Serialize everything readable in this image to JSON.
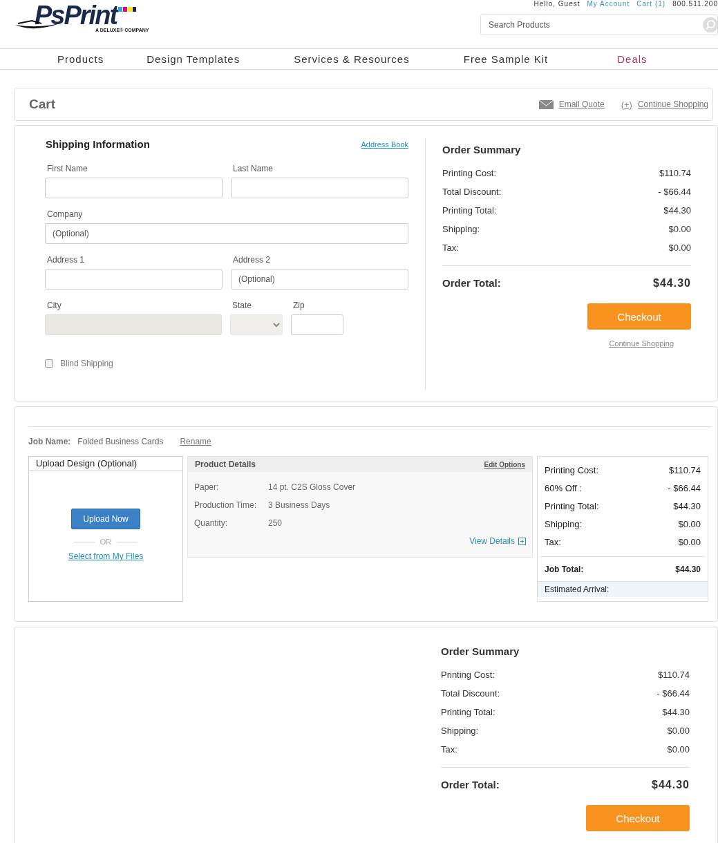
{
  "header": {
    "logo": {
      "name": "PsPrint",
      "tagline": "A DELUXE® COMPANY"
    },
    "greeting": "Hello, Guest",
    "account_link": "My Account",
    "cart_link": "Cart (1)",
    "phone": "800.511.200",
    "search": {
      "placeholder": "Search Products"
    }
  },
  "nav": [
    {
      "label": "Products",
      "kind": "normal"
    },
    {
      "label": "Design Templates",
      "kind": "normal"
    },
    {
      "label": "Services & Resources",
      "kind": "normal"
    },
    {
      "label": "Free Sample Kit",
      "kind": "normal"
    },
    {
      "label": "Deals",
      "kind": "promo"
    }
  ],
  "cart_bar": {
    "title": "Cart",
    "links": [
      {
        "label": "Email Quote",
        "kind": "email"
      },
      {
        "label": "Continue Shopping",
        "kind": "add",
        "icon": "(+)"
      }
    ]
  },
  "shipping": {
    "title": "Shipping Information",
    "address_book": "Address Book",
    "rows": [
      [
        {
          "label": "First Name",
          "kind": "text",
          "disabled": false
        },
        {
          "label": "Last Name",
          "kind": "text",
          "disabled": false
        }
      ],
      [
        {
          "label": "Company",
          "kind": "text",
          "placeholder": "(Optional)",
          "disabled": false
        }
      ],
      [
        {
          "label": "Address 1",
          "kind": "text",
          "disabled": false
        },
        {
          "label": "Address 2",
          "kind": "text",
          "placeholder": "(Optional)",
          "disabled": false
        }
      ],
      [
        {
          "label": "City",
          "kind": "text",
          "disabled": true
        },
        {
          "label": "State",
          "kind": "select",
          "disabled": true
        },
        {
          "label": "Zip",
          "kind": "text",
          "disabled": false
        }
      ]
    ],
    "blind_shipping": {
      "label": "Blind Shipping",
      "checked": false
    }
  },
  "order_summary": {
    "title": "Order Summary",
    "lines": [
      {
        "label": "Printing Cost:",
        "value": "$110.74"
      },
      {
        "label": "Total Discount:",
        "value": "- $66.44"
      },
      {
        "label": "Printing Total:",
        "value": "$44.30"
      },
      {
        "label": "Shipping:",
        "value": "$0.00"
      },
      {
        "label": "Tax:",
        "value": "$0.00"
      }
    ],
    "total": {
      "label": "Order Total:",
      "value": "$44.30"
    },
    "checkout": "Checkout",
    "continue": "Continue Shopping"
  },
  "job": {
    "job_name_label": "Job Name:",
    "job_name": "Folded Business Cards",
    "rename": "Rename",
    "upload": {
      "title": "Upload Design (Optional)",
      "button": "Upload Now",
      "or": "OR",
      "select_link": "Select from My Files"
    },
    "product_details": {
      "title": "Product Details",
      "edit": "Edit Options",
      "specs": [
        {
          "label": "Paper:",
          "value": "14 pt. C2S Gloss Cover"
        },
        {
          "label": "Production Time:",
          "value": "3 Business Days"
        },
        {
          "label": "Quantity:",
          "value": "250"
        }
      ],
      "view_details": "View Details"
    },
    "price": {
      "lines": [
        {
          "label": "Printing Cost:",
          "value": "$110.74"
        },
        {
          "label": "60% Off :",
          "value": "- $66.44"
        },
        {
          "label": "Printing Total:",
          "value": "$44.30"
        },
        {
          "label": "Shipping:",
          "value": "$0.00"
        },
        {
          "label": "Tax:",
          "value": "$0.00"
        }
      ],
      "total": {
        "label": "Job Total:",
        "value": "$44.30"
      },
      "estimated_arrival": "Estimated Arrival:"
    }
  },
  "bottom_summary": {
    "title": "Order Summary",
    "lines": [
      {
        "label": "Printing Cost:",
        "value": "$110.74"
      },
      {
        "label": "Total Discount:",
        "value": "- $66.44"
      },
      {
        "label": "Printing Total:",
        "value": "$44.30"
      },
      {
        "label": "Shipping:",
        "value": "$0.00"
      },
      {
        "label": "Tax:",
        "value": "$0.00"
      }
    ],
    "total": {
      "label": "Order Total:",
      "value": "$44.30"
    },
    "checkout": "Checkout"
  }
}
